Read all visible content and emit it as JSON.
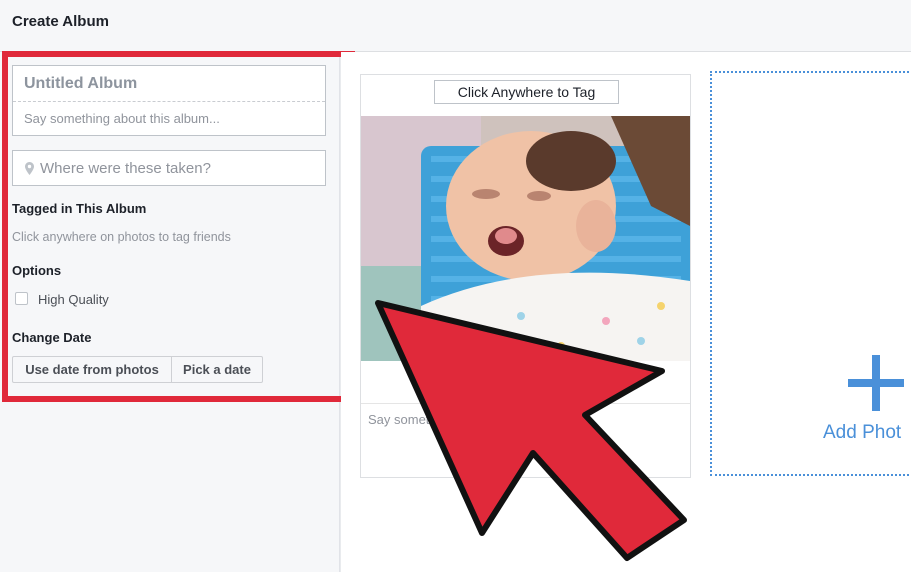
{
  "header": {
    "title": "Create Album"
  },
  "album": {
    "title_placeholder": "Untitled Album",
    "description_placeholder": "Say something about this album..."
  },
  "location": {
    "placeholder": "Where were these taken?",
    "icon": "map-pin-icon"
  },
  "tagged": {
    "heading": "Tagged in This Album",
    "hint": "Click anywhere on photos to tag friends"
  },
  "options": {
    "heading": "Options",
    "high_quality_label": "High Quality",
    "high_quality_checked": false
  },
  "change_date": {
    "heading": "Change Date",
    "use_photos_label": "Use date from photos",
    "pick_date_label": "Pick a date"
  },
  "photo": {
    "tag_button_label": "Click Anywhere to Tag",
    "caption_placeholder": "Say someth"
  },
  "add_photo": {
    "label": "Add Phot",
    "icon": "plus-icon"
  },
  "colors": {
    "highlight": "#e0293a",
    "accent_blue": "#4a90d9"
  }
}
